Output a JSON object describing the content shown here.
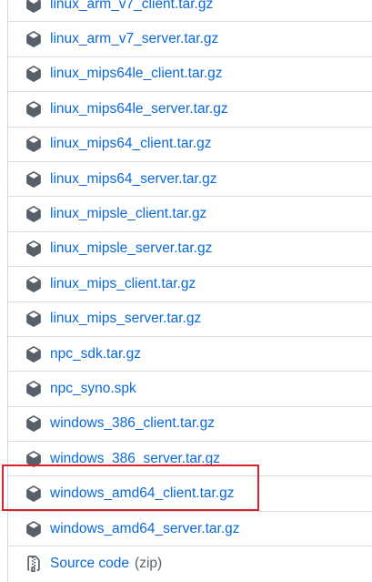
{
  "assets": [
    {
      "name": "linux_arm_v7_client.tar.gz",
      "icon": "package-icon"
    },
    {
      "name": "linux_arm_v7_server.tar.gz",
      "icon": "package-icon"
    },
    {
      "name": "linux_mips64le_client.tar.gz",
      "icon": "package-icon"
    },
    {
      "name": "linux_mips64le_server.tar.gz",
      "icon": "package-icon"
    },
    {
      "name": "linux_mips64_client.tar.gz",
      "icon": "package-icon"
    },
    {
      "name": "linux_mips64_server.tar.gz",
      "icon": "package-icon"
    },
    {
      "name": "linux_mipsle_client.tar.gz",
      "icon": "package-icon"
    },
    {
      "name": "linux_mipsle_server.tar.gz",
      "icon": "package-icon"
    },
    {
      "name": "linux_mips_client.tar.gz",
      "icon": "package-icon"
    },
    {
      "name": "linux_mips_server.tar.gz",
      "icon": "package-icon"
    },
    {
      "name": "npc_sdk.tar.gz",
      "icon": "package-icon"
    },
    {
      "name": "npc_syno.spk",
      "icon": "package-icon"
    },
    {
      "name": "windows_386_client.tar.gz",
      "icon": "package-icon"
    },
    {
      "name": "windows_386_server.tar.gz",
      "icon": "package-icon"
    },
    {
      "name": "windows_amd64_client.tar.gz",
      "icon": "package-icon"
    },
    {
      "name": "windows_amd64_server.tar.gz",
      "icon": "package-icon"
    }
  ],
  "source_code": {
    "label": "Source code",
    "suffix": "(zip)",
    "icon": "file-zip-icon"
  },
  "colors": {
    "link": "#0969da",
    "icon": "#57606a",
    "highlight": "#d8232a"
  }
}
